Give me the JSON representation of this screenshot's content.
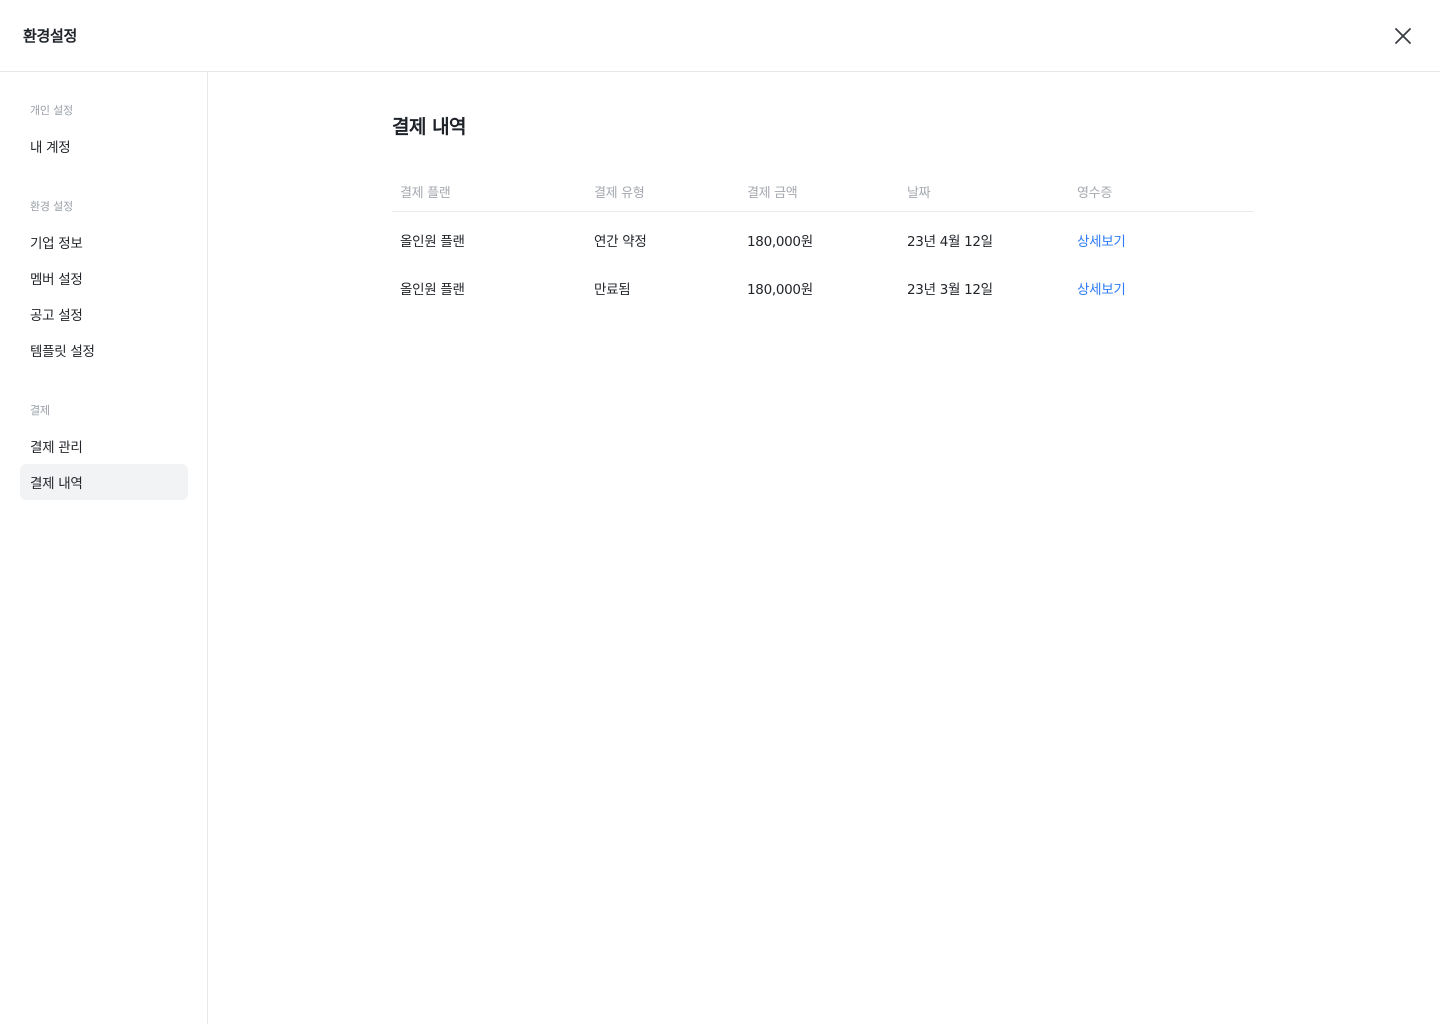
{
  "header": {
    "title": "환경설정",
    "close_icon": "close-icon"
  },
  "sidebar": {
    "sections": [
      {
        "label": "개인 설정",
        "items": [
          {
            "label": "내 계정"
          }
        ]
      },
      {
        "label": "환경 설정",
        "items": [
          {
            "label": "기업 정보"
          },
          {
            "label": "멤버 설정"
          },
          {
            "label": "공고 설정"
          },
          {
            "label": "템플릿 설정"
          }
        ]
      },
      {
        "label": "결제",
        "items": [
          {
            "label": "결제 관리"
          },
          {
            "label": "결제 내역",
            "active": true
          }
        ]
      }
    ]
  },
  "main": {
    "title": "결제 내역",
    "table": {
      "columns": [
        "결제 플랜",
        "결제 유형",
        "결제 금액",
        "날짜",
        "영수증"
      ],
      "rows": [
        {
          "plan": "올인원 플랜",
          "type": "연간 약정",
          "amount": "180,000원",
          "date": "23년 4월 12일",
          "receipt": "상세보기"
        },
        {
          "plan": "올인원 플랜",
          "type": "만료됨",
          "amount": "180,000원",
          "date": "23년 3월 12일",
          "receipt": "상세보기"
        }
      ]
    }
  },
  "colors": {
    "link": "#2e7cf6",
    "active_bg": "#f2f3f5",
    "border": "#e6e8eb",
    "muted_text": "#9aa0a7"
  }
}
